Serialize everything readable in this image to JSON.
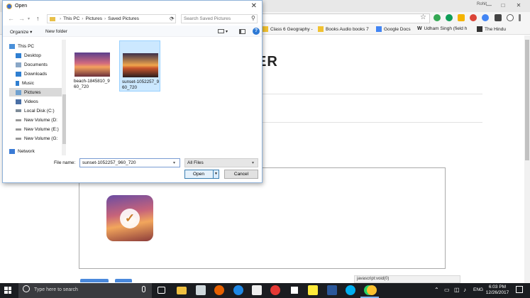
{
  "browser": {
    "window_title": "Rohit",
    "controls": {
      "minimize": "—",
      "maximize": "□",
      "close": "✕"
    },
    "bookmarks": [
      {
        "label": "Class 6 Geography -",
        "icon": "folder-icon",
        "color": "#f1c232"
      },
      {
        "label": "Books Audio books 7",
        "icon": "folder-icon",
        "color": "#f1c232"
      },
      {
        "label": "Google Docs",
        "icon": "docs-icon",
        "color": "#4285f4"
      },
      {
        "label": "Udham Singh (field h",
        "icon": "wikipedia-icon",
        "color": "#222222"
      },
      {
        "label": "The Hindu",
        "icon": "newspaper-icon",
        "color": "#333333"
      }
    ],
    "status_url": "javascript:void(0)"
  },
  "page": {
    "heading": "ER"
  },
  "dialog": {
    "title": "Open",
    "breadcrumb": [
      "This PC",
      "Pictures",
      "Saved Pictures"
    ],
    "search_placeholder": "Search Saved Pictures",
    "toolbar": {
      "organize": "Organize ▾",
      "new_folder": "New folder",
      "help": "?"
    },
    "nav_items": [
      {
        "label": "This PC",
        "icon": "computer-icon",
        "color": "#4a90d9"
      },
      {
        "label": "Desktop",
        "icon": "desktop-icon",
        "color": "#2f7fd1"
      },
      {
        "label": "Documents",
        "icon": "documents-icon",
        "color": "#8aa7c7"
      },
      {
        "label": "Downloads",
        "icon": "downloads-icon",
        "color": "#2f7fd1"
      },
      {
        "label": "Music",
        "icon": "music-icon",
        "color": "#2f7fd1"
      },
      {
        "label": "Pictures",
        "icon": "pictures-icon",
        "color": "#6fa0cf"
      },
      {
        "label": "Videos",
        "icon": "videos-icon",
        "color": "#4a6fa5"
      },
      {
        "label": "Local Disk (C:)",
        "icon": "drive-icon",
        "color": "#7f8c99"
      },
      {
        "label": "New Volume (D:",
        "icon": "drive-icon",
        "color": "#9a9a9a"
      },
      {
        "label": "New Volume (E:)",
        "icon": "drive-icon",
        "color": "#9a9a9a"
      },
      {
        "label": "New Volume (G:",
        "icon": "drive-icon",
        "color": "#9a9a9a"
      },
      {
        "label": "Network",
        "icon": "network-icon",
        "color": "#3a7bd5"
      }
    ],
    "files": [
      {
        "name": "beach-1845810_960_720",
        "selected": false
      },
      {
        "name": "sunset-1052257_960_720",
        "selected": true
      }
    ],
    "file_name_label": "File name:",
    "file_name_value": "sunset-1052257_960_720",
    "file_type": "All Files",
    "open_label": "Open",
    "cancel_label": "Cancel"
  },
  "taskbar": {
    "search_placeholder": "Type here to search",
    "apps": [
      {
        "icon": "task-view-icon",
        "color": "#ffffff"
      },
      {
        "icon": "file-explorer-icon",
        "color": "#f0c040"
      },
      {
        "icon": "store-icon",
        "color": "#cfd8dc"
      },
      {
        "icon": "firefox-icon",
        "color": "#e66000"
      },
      {
        "icon": "edge-icon",
        "color": "#1e88e5"
      },
      {
        "icon": "camera-icon",
        "color": "#eeeeee"
      },
      {
        "icon": "opera-icon",
        "color": "#e53935"
      },
      {
        "icon": "photos-icon",
        "color": "#ffffff"
      },
      {
        "icon": "sticky-notes-icon",
        "color": "#ffeb3b"
      },
      {
        "icon": "word-icon",
        "color": "#2b579a"
      },
      {
        "icon": "skype-icon",
        "color": "#00aff0"
      },
      {
        "icon": "whatsapp-icon",
        "color": "#25d366"
      },
      {
        "icon": "chrome-icon",
        "color": "#fbc02d"
      }
    ],
    "language": "ENG",
    "time": "6:03 PM",
    "date": "12/26/2017"
  }
}
